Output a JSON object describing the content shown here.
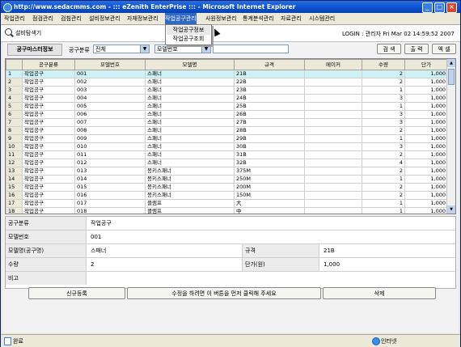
{
  "window": {
    "title": "http://www.sedacmms.com - ::: eZenith EnterPrise ::: - Microsoft Internet Explorer"
  },
  "menu": [
    "작업관리",
    "점검관리",
    "검침관리",
    "설비정보관리",
    "자재정보관리",
    "작업공구관리",
    "사원정보관리",
    "통계분석관리",
    "자료관리",
    "시스템관리"
  ],
  "dropdown": [
    "작업공구정보",
    "작업공구조회"
  ],
  "infobar": {
    "app_name": "설비탐색기",
    "login": "LOGIN : 관리자    Fri Mar 02 14:59:52 2007"
  },
  "panel": {
    "title": "공구마스터정보",
    "filter_label": "공구분류",
    "filter_value": "전체",
    "field_select": "모델번호",
    "btn_search": "검 색",
    "btn_print": "출 력",
    "btn_excel": "엑 셀"
  },
  "grid": {
    "columns": [
      "",
      "공구분류",
      "모델번호",
      "모델명",
      "규격",
      "메이커",
      "수량",
      "단가"
    ],
    "rows": [
      [
        "1",
        "작업공구",
        "001",
        "스패너",
        "21B",
        "",
        "2",
        "1,000"
      ],
      [
        "2",
        "작업공구",
        "002",
        "스패너",
        "22B",
        "",
        "2",
        "1,000"
      ],
      [
        "3",
        "작업공구",
        "003",
        "스패너",
        "23B",
        "",
        "1",
        "1,000"
      ],
      [
        "4",
        "작업공구",
        "004",
        "스패너",
        "24B",
        "",
        "3",
        "1,000"
      ],
      [
        "5",
        "작업공구",
        "005",
        "스패너",
        "25B",
        "",
        "1",
        "1,000"
      ],
      [
        "6",
        "작업공구",
        "006",
        "스패너",
        "26B",
        "",
        "3",
        "1,000"
      ],
      [
        "7",
        "작업공구",
        "007",
        "스패너",
        "27B",
        "",
        "3",
        "1,000"
      ],
      [
        "8",
        "작업공구",
        "008",
        "스패너",
        "28B",
        "",
        "2",
        "1,000"
      ],
      [
        "9",
        "작업공구",
        "009",
        "스패너",
        "29B",
        "",
        "1",
        "1,000"
      ],
      [
        "10",
        "작업공구",
        "010",
        "스패너",
        "30B",
        "",
        "3",
        "1,000"
      ],
      [
        "11",
        "작업공구",
        "011",
        "스패너",
        "31B",
        "",
        "2",
        "1,000"
      ],
      [
        "12",
        "작업공구",
        "012",
        "스패너",
        "32B",
        "",
        "4",
        "1,000"
      ],
      [
        "13",
        "작업공구",
        "013",
        "몽키스패너",
        "375M",
        "",
        "2",
        "1,000"
      ],
      [
        "14",
        "작업공구",
        "014",
        "몽키스패너",
        "250M",
        "",
        "1",
        "1,000"
      ],
      [
        "15",
        "작업공구",
        "015",
        "몽키스패너",
        "200M",
        "",
        "2",
        "1,000"
      ],
      [
        "16",
        "작업공구",
        "016",
        "몽키스패너",
        "150M",
        "",
        "2",
        "1,000"
      ],
      [
        "17",
        "작업공구",
        "017",
        "클램프",
        "大",
        "",
        "1",
        "1,000"
      ],
      [
        "18",
        "작업공구",
        "018",
        "클램프",
        "中",
        "",
        "1",
        "1,000"
      ]
    ]
  },
  "detail": {
    "category_label": "공구분류",
    "category_value": "작업공구",
    "model_no_label": "모델번호",
    "model_no_value": "001",
    "model_name_label": "모델명(공구명)",
    "model_name_value": "스패너",
    "spec_label": "규격",
    "spec_value": "21B",
    "qty_label": "수량",
    "qty_value": "2",
    "price_label": "단가(원)",
    "price_value": "1,000",
    "note_label": "비고",
    "note_value": ""
  },
  "actions": {
    "new": "신규등록",
    "edit": "수정을 하려면 이 버튼을 먼저 클릭해 주세요",
    "delete": "삭제"
  },
  "status": {
    "left": "완료",
    "right": "인터넷"
  }
}
